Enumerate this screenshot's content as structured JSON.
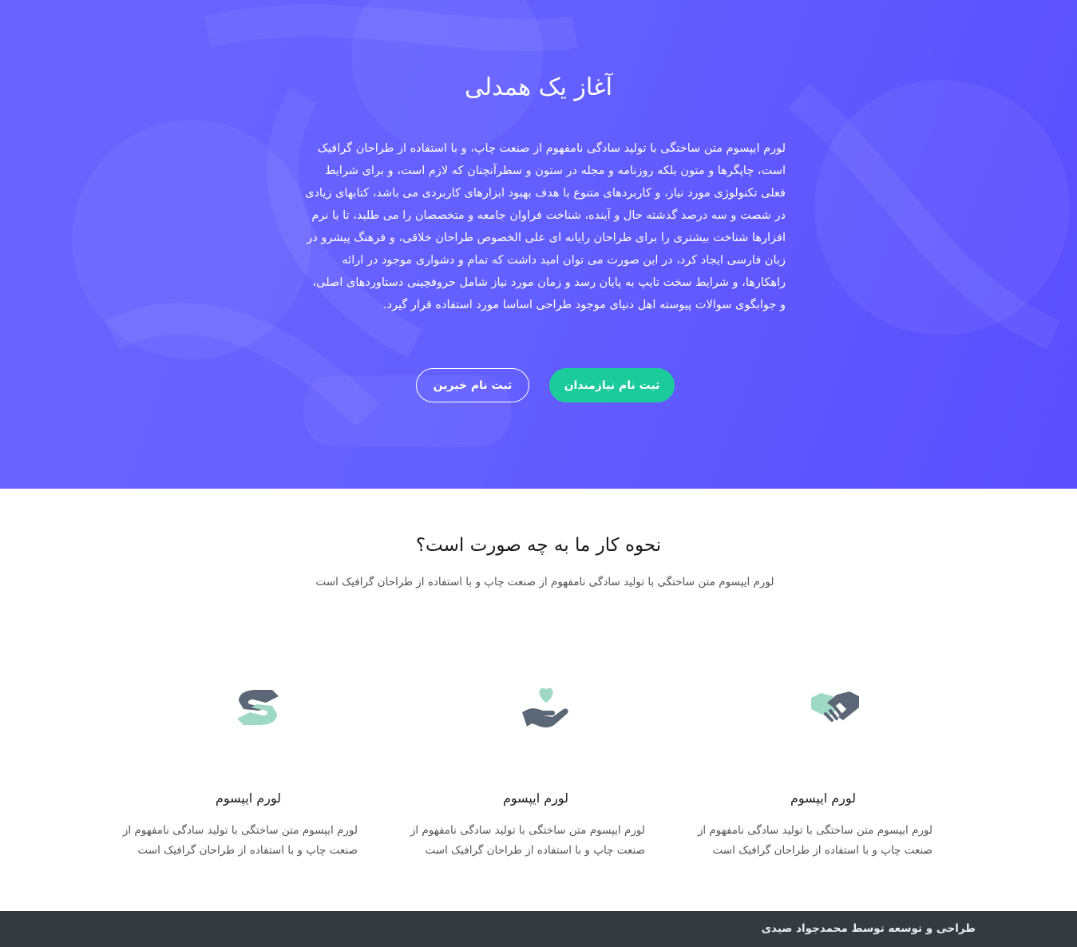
{
  "hero": {
    "title": "آغاز یک همدلی",
    "body": "لورم ایپسوم متن ساختگی با تولید سادگی نامفهوم از صنعت چاپ، و با استفاده از طراحان گرافیک است، چاپگرها و متون بلکه روزنامه و مجله در ستون و سطرآنچنان که لازم است، و برای شرایط فعلی تکنولوژی مورد نیاز، و کاربردهای متنوع با هدف بهبود ابزارهای کاربردی می باشد، کتابهای زیادی در شصت و سه درصد گذشته حال و آینده، شناخت فراوان جامعه و متخصصان را می طلبد، تا با نرم افزارها شناخت بیشتری را برای طراحان رایانه ای علی الخصوص طراحان خلاقی، و فرهنگ پیشرو در زبان فارسی ایجاد کرد، در این صورت می توان امید داشت که تمام و دشواری موجود در ارائه راهکارها، و شرایط سخت تایپ به پایان رسد و زمان مورد نیاز شامل حروفچینی دستاوردهای اصلی، و جوابگوی سوالات پیوسته اهل دنیای موجود طراحی اساسا مورد استفاده قرار گیرد.",
    "btn_primary": "ثبت نام نیازمندان",
    "btn_secondary": "ثبت نام خیرین"
  },
  "how": {
    "title": "نحوه کار ما به چه صورت است؟",
    "subtitle": "لورم ایپسوم متن ساختگی با تولید سادگی نامفهوم از صنعت چاپ و با استفاده از طراحان گرافیک است"
  },
  "features": [
    {
      "icon": "handshake-icon",
      "title": "لورم ایپسوم",
      "text": "لورم ایپسوم متن ساختگی با تولید سادگی نامفهوم از صنعت چاپ و با استفاده از طراحان گرافیک است"
    },
    {
      "icon": "hand-heart-icon",
      "title": "لورم ایپسوم",
      "text": "لورم ایپسوم متن ساختگی با تولید سادگی نامفهوم از صنعت چاپ و با استفاده از طراحان گرافیک است"
    },
    {
      "icon": "helping-hands-icon",
      "title": "لورم ایپسوم",
      "text": "لورم ایپسوم متن ساختگی با تولید سادگی نامفهوم از صنعت چاپ و با استفاده از طراحان گرافیک است"
    }
  ],
  "footer": {
    "credit": "طراحی و توسعه توسط محمدجواد صیدی"
  },
  "colors": {
    "hero_start": "#6b63ff",
    "hero_end": "#5a4dfe",
    "accent_green": "#1ccb9c",
    "icon_mint": "#9fd8c4",
    "icon_slate": "#5b6676",
    "footer_bg": "#343a40"
  }
}
